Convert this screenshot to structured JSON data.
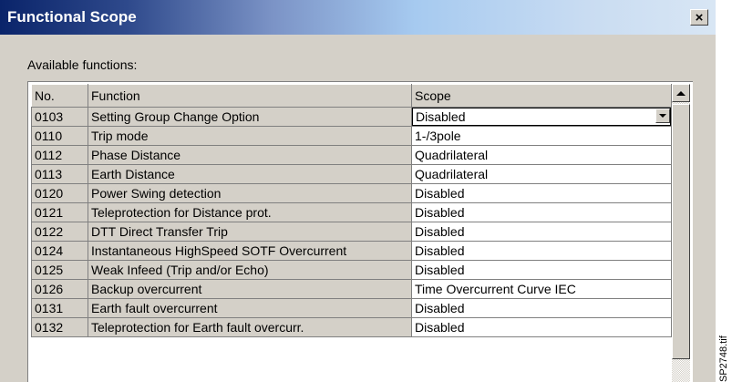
{
  "window": {
    "title": "Functional Scope",
    "close_label": "×"
  },
  "available_label": "Available functions:",
  "table": {
    "columns": [
      "No.",
      "Function",
      "Scope"
    ],
    "rows": [
      {
        "no": "0103",
        "function": "Setting Group Change Option",
        "scope": "Disabled"
      },
      {
        "no": "0110",
        "function": "Trip mode",
        "scope": "1-/3pole"
      },
      {
        "no": "0112",
        "function": "Phase Distance",
        "scope": "Quadrilateral"
      },
      {
        "no": "0113",
        "function": "Earth Distance",
        "scope": "Quadrilateral"
      },
      {
        "no": "0120",
        "function": "Power Swing detection",
        "scope": "Disabled"
      },
      {
        "no": "0121",
        "function": "Teleprotection for Distance prot.",
        "scope": "Disabled"
      },
      {
        "no": "0122",
        "function": "DTT Direct Transfer Trip",
        "scope": "Disabled"
      },
      {
        "no": "0124",
        "function": "Instantaneous HighSpeed SOTF Overcurrent",
        "scope": "Disabled"
      },
      {
        "no": "0125",
        "function": "Weak Infeed (Trip and/or Echo)",
        "scope": "Disabled"
      },
      {
        "no": "0126",
        "function": "Backup overcurrent",
        "scope": "Time Overcurrent Curve IEC"
      },
      {
        "no": "0131",
        "function": "Earth fault overcurrent",
        "scope": "Disabled"
      },
      {
        "no": "0132",
        "function": "Teleprotection for Earth fault overcurr.",
        "scope": "Disabled"
      }
    ]
  },
  "side_label": "SP2748.tif",
  "icons": {
    "close": "close-icon",
    "dropdown": "chevron-down-icon",
    "scroll_up": "arrow-up-icon"
  },
  "colors": {
    "titlebar_start": "#0a246a",
    "titlebar_end": "#d8e6f4",
    "window_bg": "#d4d0c8"
  }
}
